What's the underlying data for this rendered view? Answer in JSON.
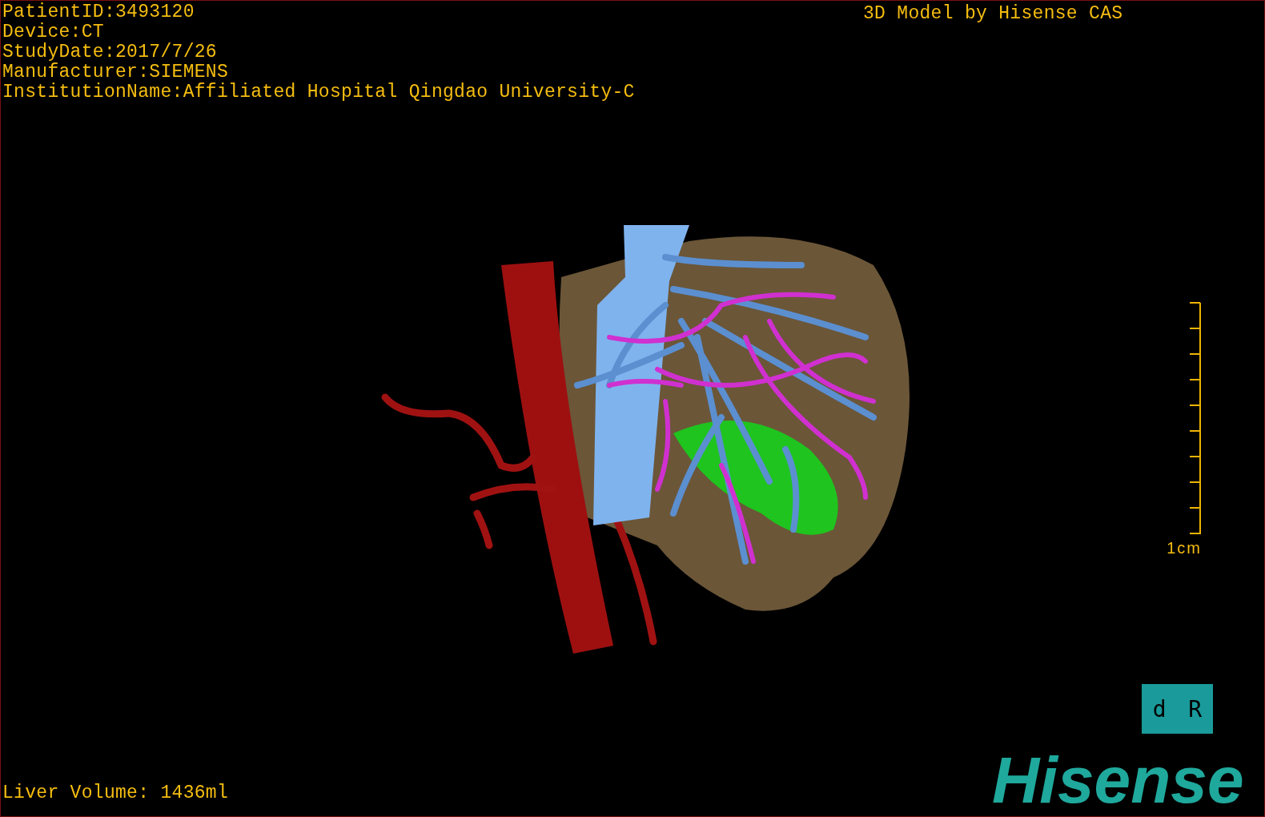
{
  "info_lines": [
    "PatientID:3493120",
    "Device:CT",
    "StudyDate:2017/7/26",
    "Manufacturer:SIEMENS",
    "InstitutionName:Affiliated Hospital Qingdao University-C"
  ],
  "title": "3D Model by Hisense CAS",
  "scale_bar": {
    "label": "1cm"
  },
  "orientation_cube": {
    "labels": [
      "d",
      "R"
    ]
  },
  "logo": "Hisense",
  "liver_volume": "Liver Volume: 1436ml"
}
